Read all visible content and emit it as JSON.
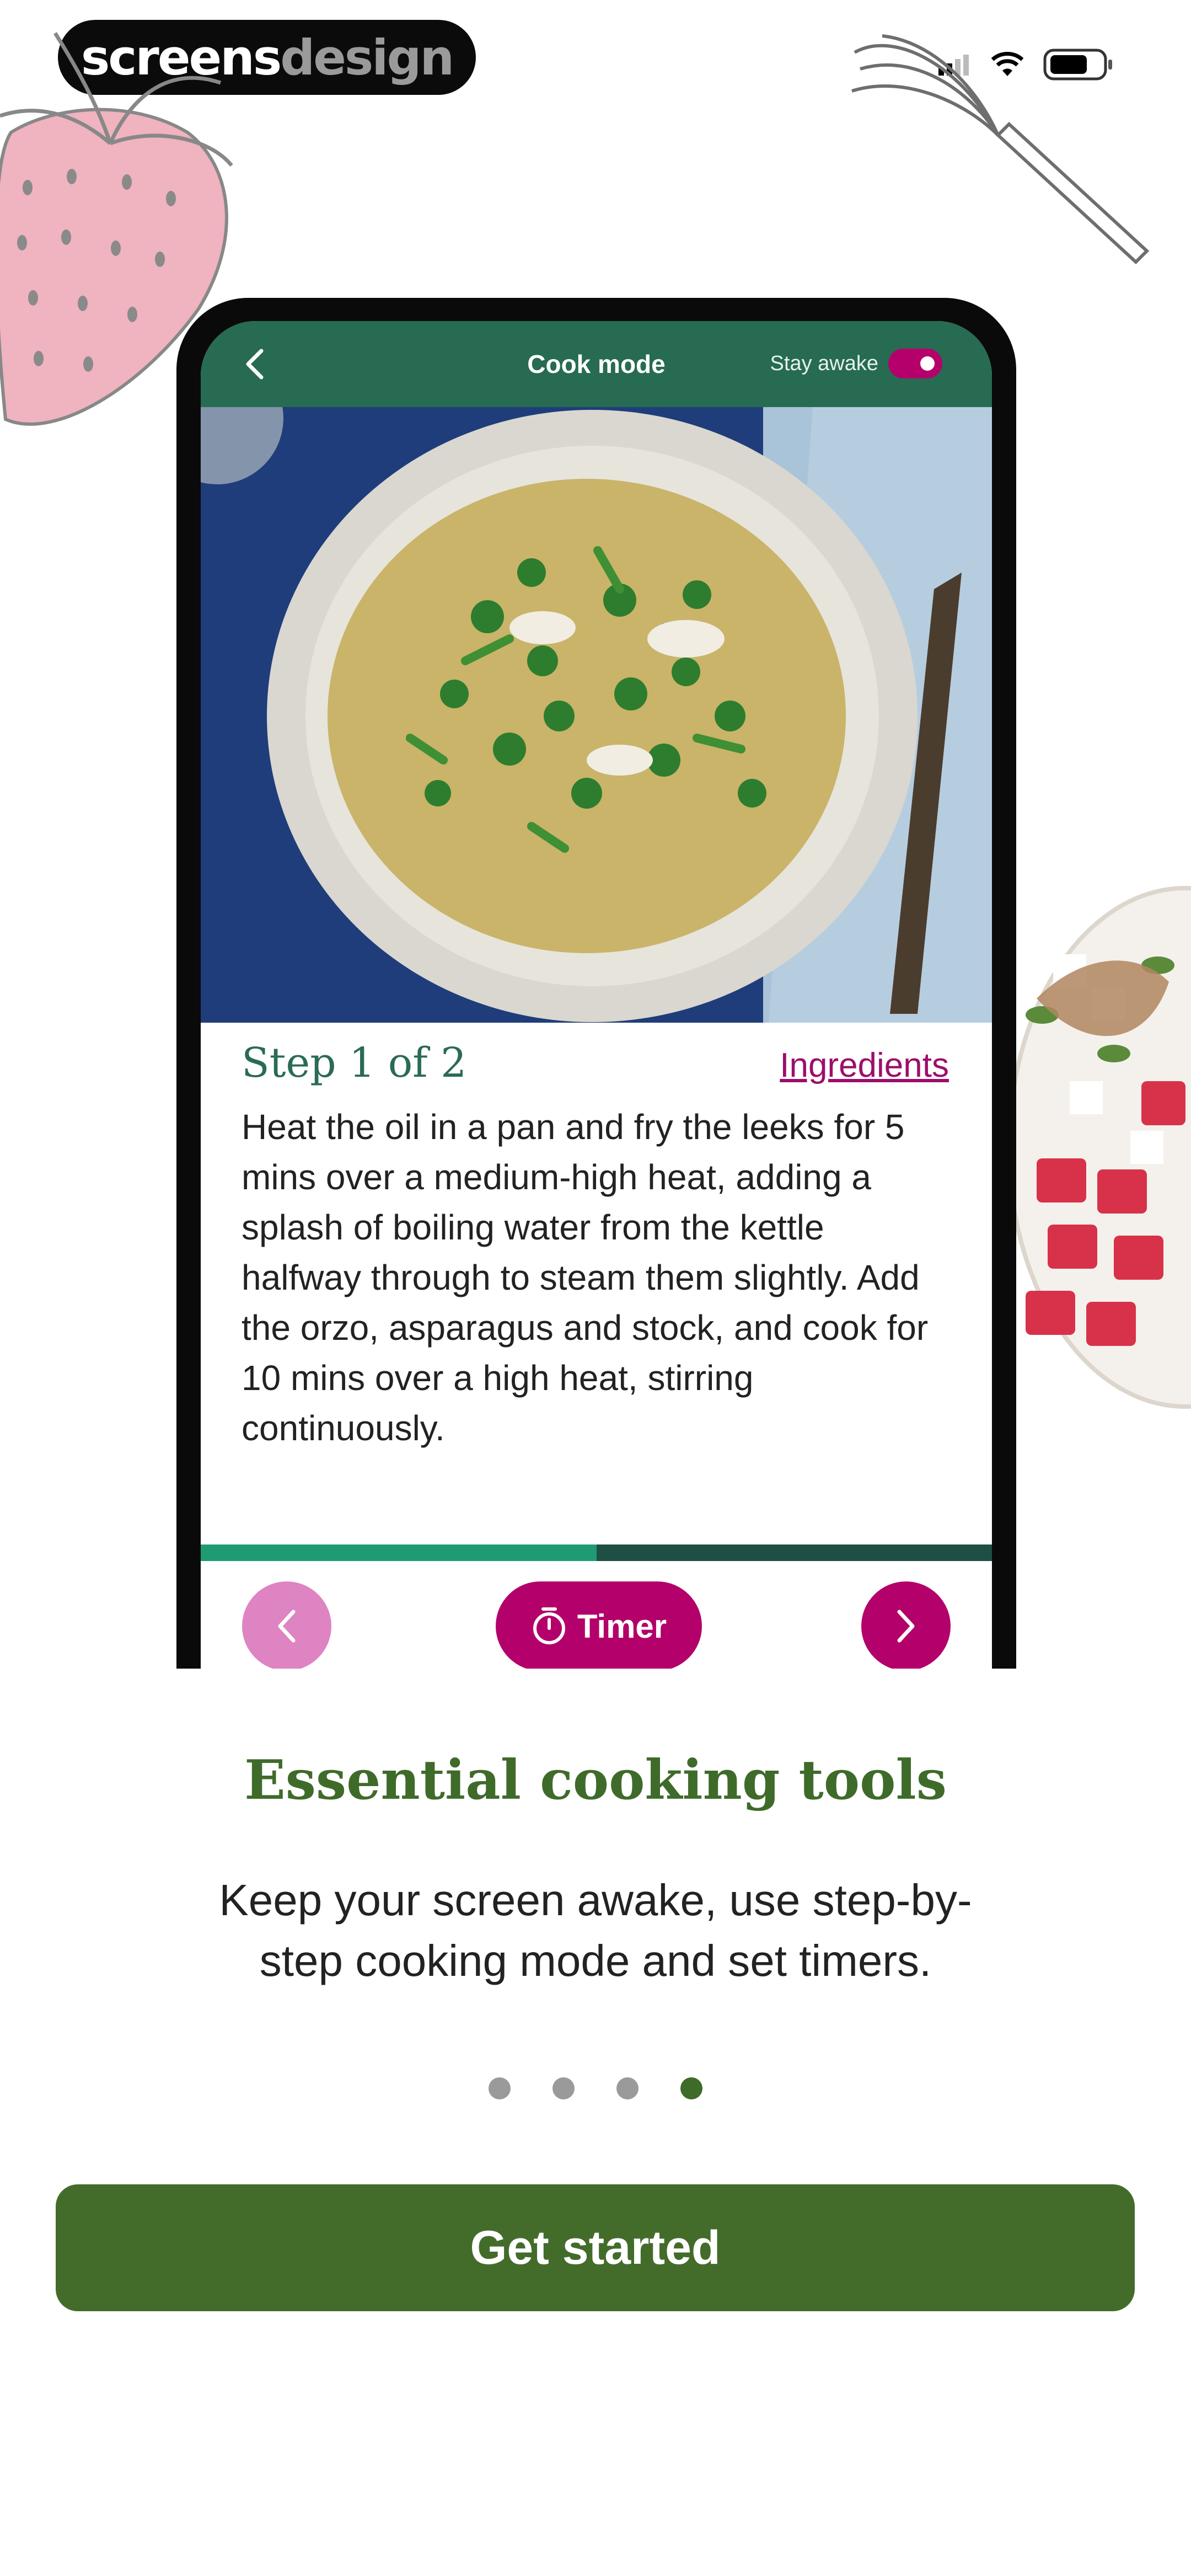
{
  "watermark": {
    "brand_part1": "screens",
    "brand_part2": "design"
  },
  "status_bar": {
    "signal_icon": "signal-icon",
    "wifi_icon": "wifi-icon",
    "battery_icon": "battery-icon"
  },
  "phone_screen": {
    "header": {
      "title": "Cook mode",
      "stay_awake_label": "Stay awake",
      "stay_awake_on": true
    },
    "step": {
      "label": "Step 1 of 2",
      "ingredients_link": "Ingredients",
      "instruction": "Heat the oil in a pan and fry the leeks for 5 mins over a medium-high heat, adding a splash of boiling water from the kettle halfway through to steam them slightly. Add the orzo, asparagus and stock, and cook for 10 mins over a high heat, stirring continuously."
    },
    "progress_fraction": 0.5,
    "controls": {
      "timer_label": "Timer"
    }
  },
  "onboarding": {
    "heading": "Essential cooking tools",
    "subtitle_line1": "Keep your screen awake, use step-by-",
    "subtitle_line2": "step cooking mode and set timers.",
    "page_count": 4,
    "active_page": 4,
    "cta_label": "Get started"
  },
  "colors": {
    "header_green": "#266b52",
    "brand_magenta": "#b3006a",
    "heading_green": "#3f6b2a",
    "cta_green": "#436c2b"
  }
}
